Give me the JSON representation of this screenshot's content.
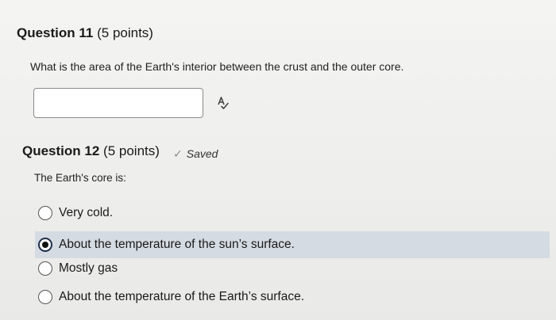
{
  "q11": {
    "number": "Question 11",
    "points": "(5 points)",
    "prompt": "What is the area of the Earth's interior between the crust and the outer core.",
    "answer_value": ""
  },
  "q12": {
    "number": "Question 12",
    "points": "(5 points)",
    "saved_label": "Saved",
    "prompt": "The Earth's core is:",
    "options": [
      {
        "label": "Very cold.",
        "selected": false
      },
      {
        "label": "About the temperature of the sun’s surface.",
        "selected": true
      },
      {
        "label": "Mostly gas",
        "selected": false
      },
      {
        "label": "About the temperature of the Earth’s surface.",
        "selected": false
      }
    ]
  },
  "icons": {
    "spellcheck": "spellcheck-icon",
    "saved": "checkmark-icon"
  },
  "colors": {
    "selected_row": "#d5dbe2"
  }
}
